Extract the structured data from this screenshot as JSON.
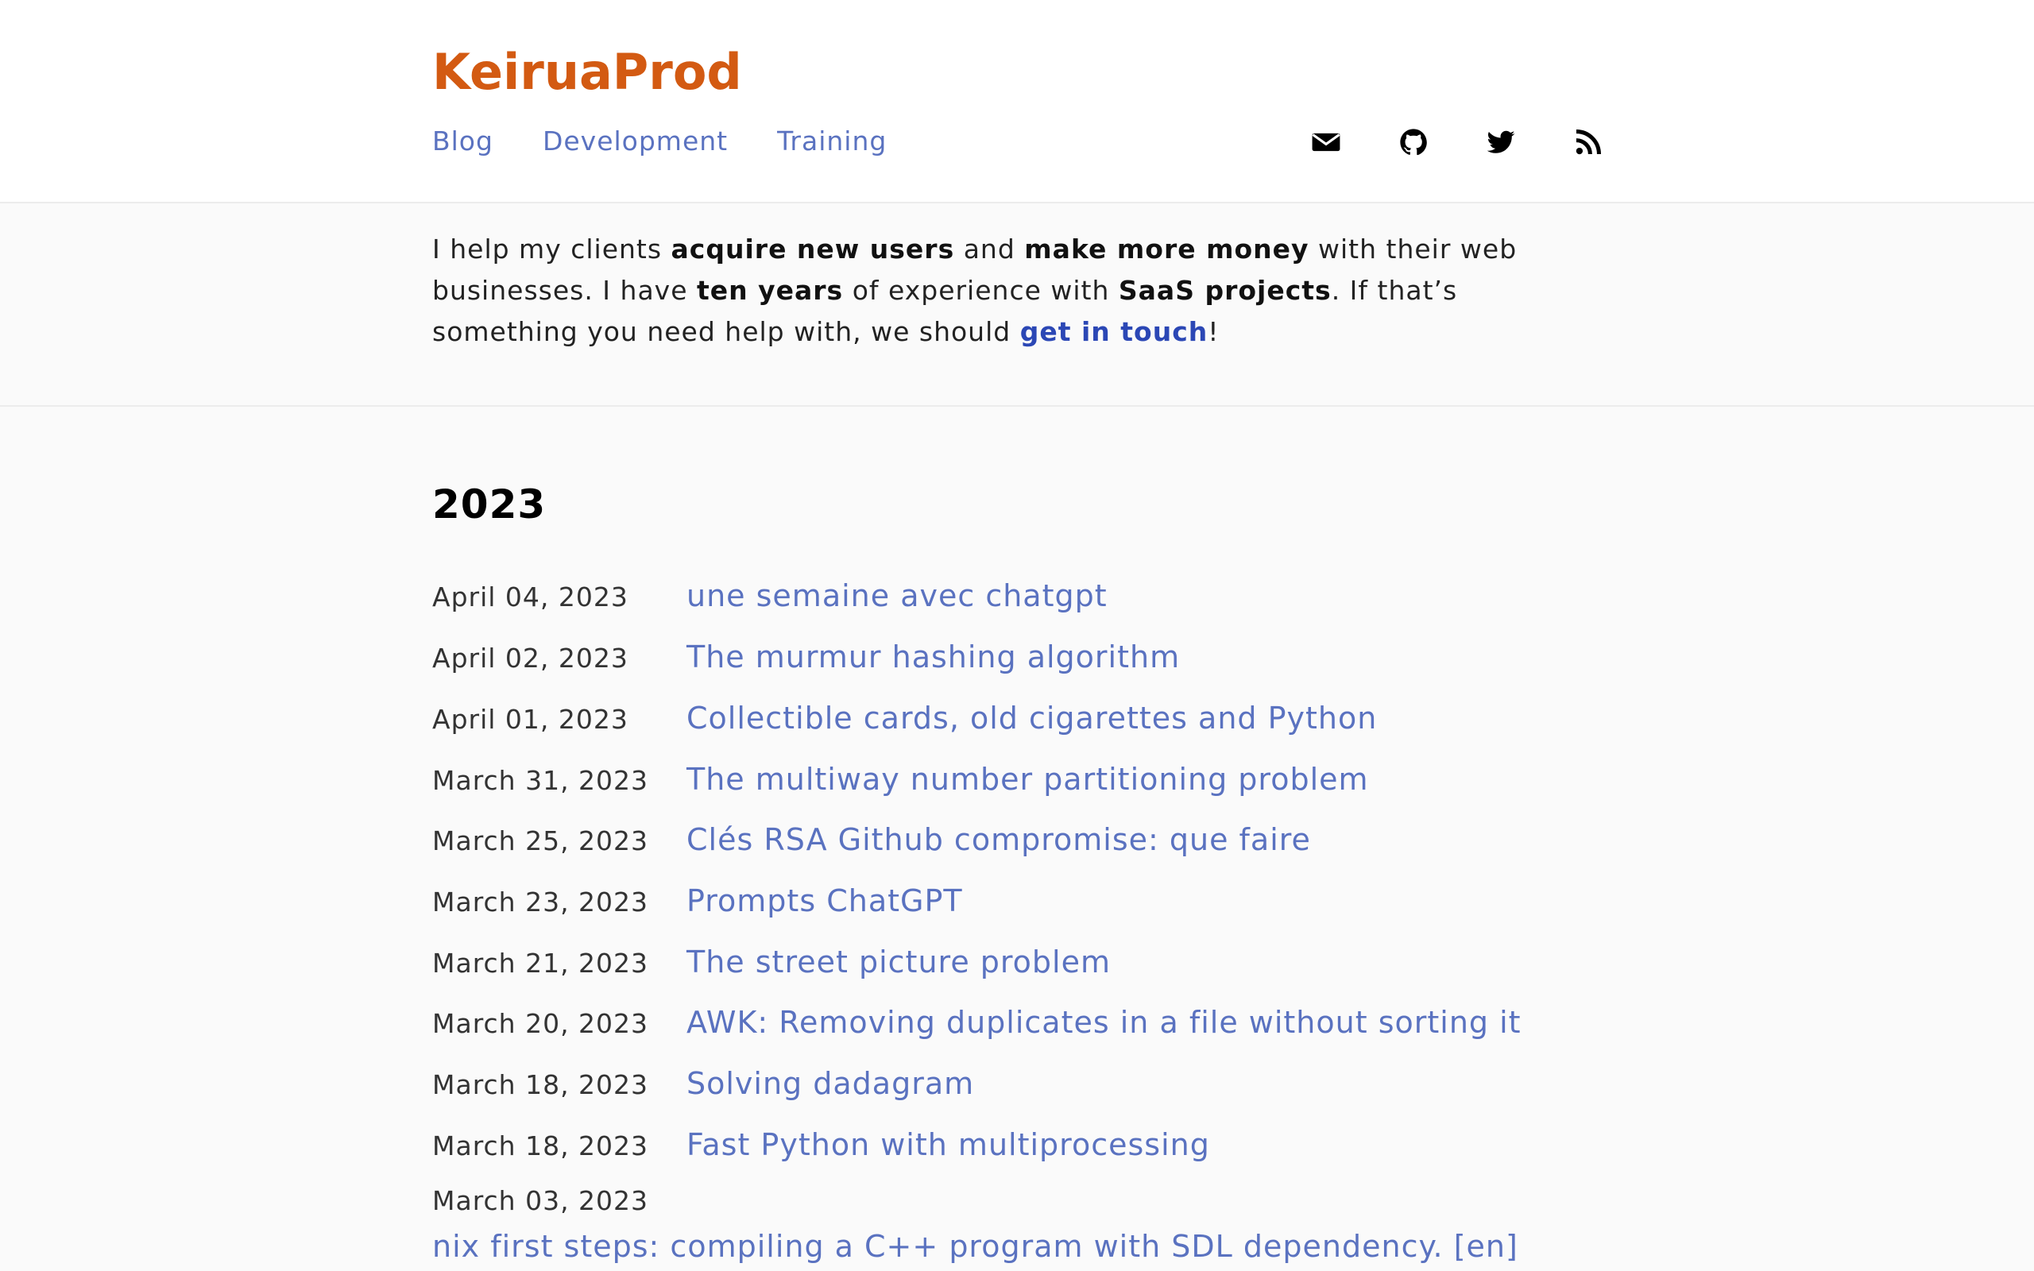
{
  "site": {
    "title": "KeiruaProd"
  },
  "nav": [
    {
      "label": "Blog"
    },
    {
      "label": "Development"
    },
    {
      "label": "Training"
    }
  ],
  "header_icons": [
    "envelope-icon",
    "github-icon",
    "twitter-icon",
    "rss-icon"
  ],
  "intro": {
    "t1": "I help my clients ",
    "b1": "acquire new users",
    "t2": " and ",
    "b2": "make more money",
    "t3": " with their web businesses. I have ",
    "b3": "ten years",
    "t4": " of experience with ",
    "b4": "SaaS projects",
    "t5": ". If that’s something you need help with, we should ",
    "link": "get in touch",
    "t6": "!"
  },
  "archive": {
    "year": "2023",
    "posts": [
      {
        "date": "April 04, 2023",
        "title": "une semaine avec chatgpt"
      },
      {
        "date": "April 02, 2023",
        "title": "The murmur hashing algorithm"
      },
      {
        "date": "April 01, 2023",
        "title": "Collectible cards, old cigarettes and Python"
      },
      {
        "date": "March 31, 2023",
        "title": "The multiway number partitioning problem"
      },
      {
        "date": "March 25, 2023",
        "title": "Clés RSA Github compromise: que faire"
      },
      {
        "date": "March 23, 2023",
        "title": "Prompts ChatGPT"
      },
      {
        "date": "March 21, 2023",
        "title": "The street picture problem"
      },
      {
        "date": "March 20, 2023",
        "title": "AWK: Removing duplicates in a file without sorting it"
      },
      {
        "date": "March 18, 2023",
        "title": "Solving dadagram"
      },
      {
        "date": "March 18, 2023",
        "title": "Fast Python with multiprocessing"
      },
      {
        "date": "March 03, 2023",
        "title": "nix first steps: compiling a C++ program with SDL dependency. [en]"
      }
    ]
  },
  "colors": {
    "brand": "#d35a12",
    "link": "#5a72c0",
    "cta": "#2b47b5"
  }
}
